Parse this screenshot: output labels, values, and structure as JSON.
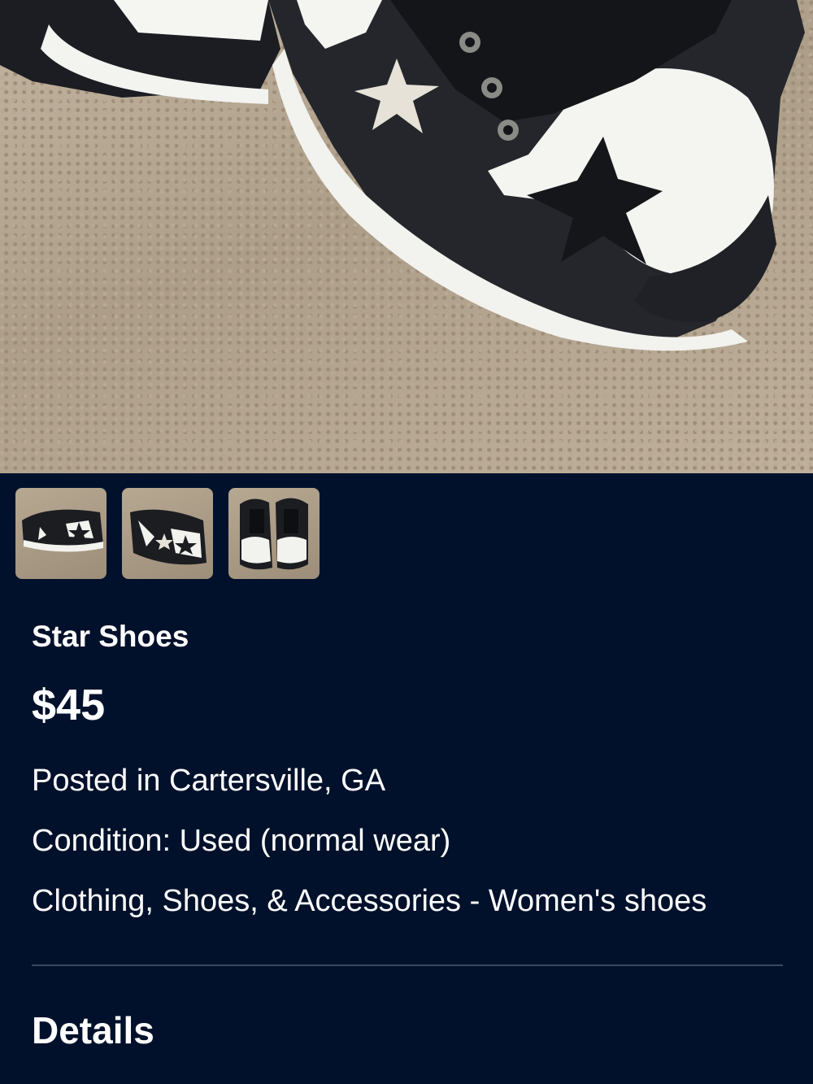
{
  "photo": {
    "main_image": "sneaker-photo",
    "thumbnails": [
      "thumbnail-1",
      "thumbnail-2",
      "thumbnail-3"
    ]
  },
  "listing": {
    "title": "Star Shoes",
    "price": "$45",
    "location": "Posted in Cartersville, GA",
    "condition": "Condition: Used (normal wear)",
    "category": "Clothing, Shoes, & Accessories - Women's shoes"
  },
  "sections": {
    "details_heading": "Details"
  },
  "colors": {
    "background": "#01112b",
    "text": "#ffffff",
    "divider": "#3a4760"
  }
}
